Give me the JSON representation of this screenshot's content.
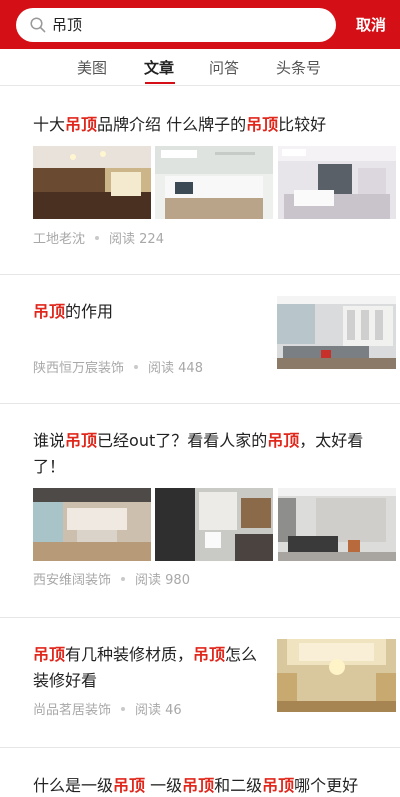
{
  "search": {
    "value": "吊顶",
    "cancel_label": "取消"
  },
  "tabs": [
    {
      "label": "美图",
      "active": false
    },
    {
      "label": "文章",
      "active": true
    },
    {
      "label": "问答",
      "active": false
    },
    {
      "label": "头条号",
      "active": false
    }
  ],
  "colors": {
    "brand": "#d40f16",
    "highlight": "#e0271c"
  },
  "articles": [
    {
      "title_parts": [
        "十大",
        "吊顶",
        "品牌介绍 什么牌子的",
        "吊顶",
        "比较好"
      ],
      "source": "工地老沈",
      "reads": "阅读 224",
      "thumb_layout": "three"
    },
    {
      "title_parts": [
        "吊顶",
        "的作用"
      ],
      "source": "陕西恒万宸装饰",
      "reads": "阅读 448",
      "thumb_layout": "single"
    },
    {
      "title_parts": [
        "谁说",
        "吊顶",
        "已经out了？看看人家的",
        "吊顶",
        "，太好看了！"
      ],
      "source": "西安维阔装饰",
      "reads": "阅读 980",
      "thumb_layout": "three"
    },
    {
      "title_parts": [
        "吊顶",
        "有几种装修材质，",
        "吊顶",
        "怎么装修好看"
      ],
      "source": "尚品茗居装饰",
      "reads": "阅读 46",
      "thumb_layout": "single"
    },
    {
      "title_parts": [
        "什么是一级",
        "吊顶",
        " 一级",
        "吊顶",
        "和二级",
        "吊顶",
        "哪个更好"
      ],
      "thumb_layout": "none"
    }
  ]
}
